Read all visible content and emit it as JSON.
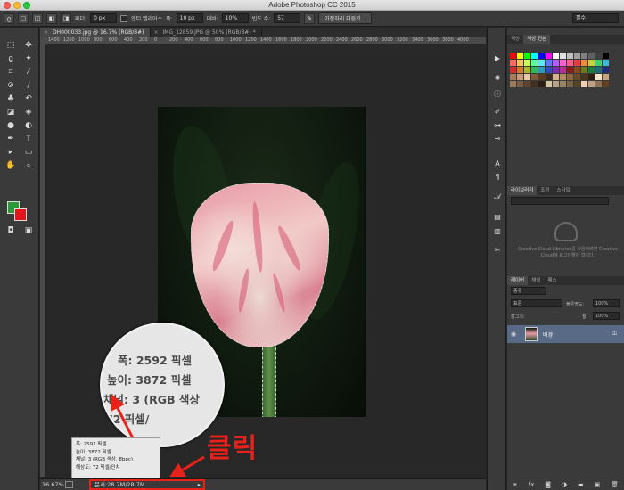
{
  "window": {
    "title": "Adobe Photoshop CC 2015"
  },
  "options_bar": {
    "feather_label": "페더:",
    "feather_value": "0 px",
    "antialias_label": "앤티 앨리어스",
    "width_label": "폭:",
    "width_value": "10 px",
    "contrast_label": "대비:",
    "contrast_value": "10%",
    "frequency_label": "빈도 수:",
    "frequency_value": "57",
    "refine_edge_button": "가장자리 다듬기...",
    "workspace_value": "필수"
  },
  "doc_tabs": [
    {
      "label": "DH000033.jpg @ 16.7% (RGB/8#)",
      "close": "×"
    },
    {
      "label": "IMG_12859.JPG @ 50% (RGB/8#) *",
      "close": "×"
    }
  ],
  "ruler_ticks": [
    "1400",
    "1200",
    "1000",
    "800",
    "600",
    "400",
    "200",
    "0",
    "200",
    "400",
    "600",
    "800",
    "1000",
    "1200",
    "1400",
    "1600",
    "1800",
    "2000",
    "2200",
    "2400",
    "2600",
    "2800",
    "3000",
    "3200",
    "3400",
    "3600",
    "3800",
    "4000"
  ],
  "magnifier": {
    "lines": [
      "폭: 2592 픽셀",
      "높이: 3872 픽셀",
      "채널: 3 (RGB 색상",
      "  72 픽셀/"
    ]
  },
  "info_popup": {
    "lines": [
      "폭: 2592 픽셀",
      "높이: 3872 픽셀",
      "채널: 3 (RGB 색상, 8bpc)",
      "해상도: 72 픽셀/인치"
    ]
  },
  "annotation": {
    "text": "클릭",
    "color": "#e8221a"
  },
  "status_bar": {
    "zoom": "16.67%",
    "doc_size": "문서:28.7M/28.7M",
    "arrow": "▸"
  },
  "right_panels": {
    "swatch_tabs": [
      "색상",
      "색상 견본"
    ],
    "library_tabs": [
      "라이브러리",
      "조정",
      "스타일"
    ],
    "cc_message": "Creative Cloud Libraries를 사용하려면 Creative Cloud에 로그인해야 합니다.",
    "layers_tabs": [
      "레이어",
      "채널",
      "패스"
    ],
    "kind_label": "종류",
    "blend_mode": "표준",
    "opacity_label": "불투명도:",
    "opacity_value": "100%",
    "lock_label": "잠그기:",
    "fill_label": "칠:",
    "fill_value": "100%",
    "layer_name": "배경"
  },
  "colors": {
    "foreground": "#2b9a3a",
    "background": "#e4141b",
    "selected_layer": "#586a85"
  }
}
